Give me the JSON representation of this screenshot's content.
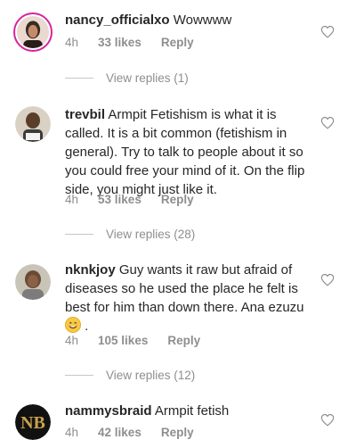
{
  "comments": [
    {
      "username": "nancy_officialxo",
      "text": "Wowwww",
      "time": "4h",
      "likes": "33 likes",
      "reply": "Reply",
      "view_replies": "View replies (1)"
    },
    {
      "username": "trevbil",
      "text": "Armpit Fetishism is what it is called. It is a bit common (fetishism in general). Try to talk to people about it so you could free your mind of it. On the flip side, you might just like it.",
      "time": "4h",
      "likes": "53 likes",
      "reply": "Reply",
      "view_replies": "View replies (28)"
    },
    {
      "username": "nknkjoy",
      "text": "Guy wants it raw but afraid of diseases so he used the place he felt is best for him than down there. Ana ezuzu",
      "time": "4h",
      "likes": "105 likes",
      "reply": "Reply",
      "view_replies": "View replies (12)"
    },
    {
      "username": "nammysbraid",
      "text": "Armpit fetish",
      "time": "4h",
      "likes": "42 likes",
      "reply": "Reply"
    }
  ],
  "icons": {
    "like": "heart-outline-icon",
    "emoji": "smiling-face-emoji"
  },
  "colors": {
    "text": "#262626",
    "meta": "#8e8e8e",
    "story_ring": "#d6249f"
  }
}
